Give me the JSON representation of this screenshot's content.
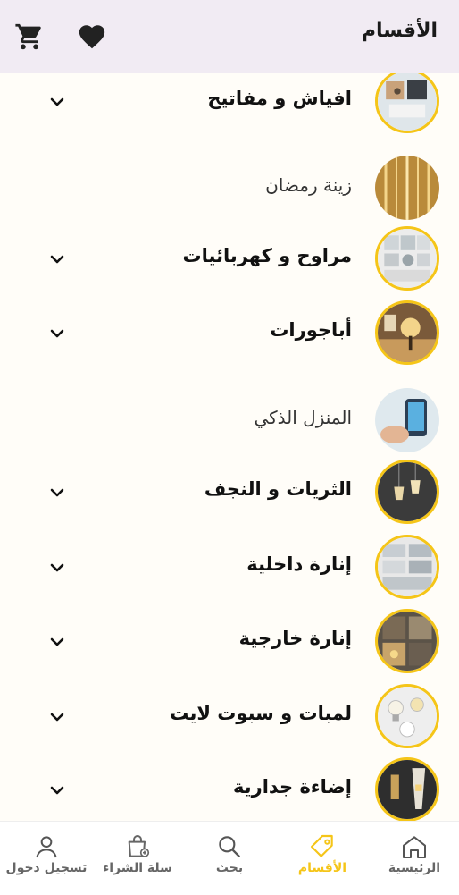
{
  "header": {
    "title": "الأقسام"
  },
  "categories": [
    {
      "label": "افياش و مفاتيح",
      "bold": true,
      "expandable": true,
      "bordered": true
    },
    {
      "label": "زينة رمضان",
      "bold": false,
      "expandable": false,
      "bordered": false
    },
    {
      "label": "مراوح و كهربائيات",
      "bold": true,
      "expandable": true,
      "bordered": true
    },
    {
      "label": "أباجورات",
      "bold": true,
      "expandable": true,
      "bordered": true
    },
    {
      "label": "المنزل الذكي",
      "bold": false,
      "expandable": false,
      "bordered": false
    },
    {
      "label": "الثريات و النجف",
      "bold": true,
      "expandable": true,
      "bordered": true
    },
    {
      "label": "إنارة داخلية",
      "bold": true,
      "expandable": true,
      "bordered": true
    },
    {
      "label": "إنارة خارجية",
      "bold": true,
      "expandable": true,
      "bordered": true
    },
    {
      "label": "لمبات و سبوت لايت",
      "bold": true,
      "expandable": true,
      "bordered": true
    },
    {
      "label": "إضاءة جدارية",
      "bold": true,
      "expandable": true,
      "bordered": true
    }
  ],
  "bottom_nav": {
    "home": "الرئيسية",
    "categories": "الأقسام",
    "search": "بحث",
    "cart": "سلة الشراء",
    "login": "تسجيل دخول"
  },
  "colors": {
    "accent": "#f5c518",
    "header_bg": "#f1ebf3",
    "background": "#fffdf8"
  }
}
